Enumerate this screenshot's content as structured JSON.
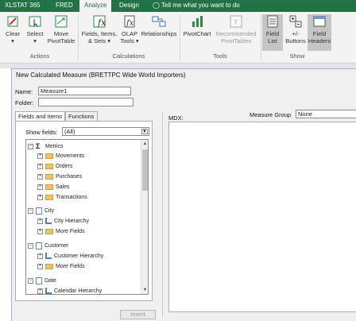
{
  "ribbon_tabs": [
    "XLSTAT 365",
    "FRED",
    "Analyze",
    "Design",
    "Tell me what you want to do"
  ],
  "ribbon": {
    "buttons": [
      {
        "label": "Clear",
        "sub": "▾"
      },
      {
        "label": "Select",
        "sub": "▾"
      },
      {
        "label": "Move",
        "sub": "PivotTable"
      },
      {
        "label": "Fields, Items,",
        "sub": "& Sets ▾"
      },
      {
        "label": "OLAP",
        "sub": "Tools ▾"
      },
      {
        "label": "Relationships",
        "sub": ""
      },
      {
        "label": "PivotChart",
        "sub": ""
      },
      {
        "label": "Recommended",
        "sub": "PivotTables"
      },
      {
        "label": "Field",
        "sub": "List"
      },
      {
        "label": "+/-",
        "sub": "Buttons"
      },
      {
        "label": "Field",
        "sub": "Headers"
      }
    ],
    "groups": [
      "Actions",
      "Calculations",
      "Tools",
      "Show"
    ]
  },
  "dialog": {
    "title": "New Calculated Measure (BRETTPC Wide World Importers)",
    "name_label": "Name:",
    "name_value": "Measure1",
    "folder_label": "Folder:",
    "folder_value": "",
    "tabs": [
      "Fields and Items",
      "Functions"
    ],
    "show_fields_label": "Show fields:",
    "show_fields_value": "(All)",
    "mdx_label": "MDX:",
    "measure_group_label": "Measure Group",
    "measure_group_value": "None",
    "insert_label": "Insert",
    "tree": [
      {
        "label": "Metrics",
        "icon": "sigma-icon",
        "exp": "−"
      },
      {
        "label": "Movements",
        "icon": "folder-icon",
        "exp": "+"
      },
      {
        "label": "Orders",
        "icon": "folder-icon",
        "exp": "+"
      },
      {
        "label": "Purchases",
        "icon": "folder-icon",
        "exp": "+"
      },
      {
        "label": "Sales",
        "icon": "folder-icon",
        "exp": "+"
      },
      {
        "label": "Transactions",
        "icon": "folder-icon",
        "exp": "+"
      },
      {
        "label": "City",
        "icon": "table-icon",
        "exp": "−"
      },
      {
        "label": "City Hierarchy",
        "icon": "hierarchy-icon",
        "exp": "+"
      },
      {
        "label": "More Fields",
        "icon": "folder-icon",
        "exp": "+"
      },
      {
        "label": "Customer",
        "icon": "table-icon",
        "exp": "−"
      },
      {
        "label": "Customer Hierarchy",
        "icon": "hierarchy-icon",
        "exp": "+"
      },
      {
        "label": "More Fields",
        "icon": "folder-icon",
        "exp": "+"
      },
      {
        "label": "Date",
        "icon": "table-icon",
        "exp": "−"
      },
      {
        "label": "Calendar Hierarchy",
        "icon": "hierarchy-icon",
        "exp": "+"
      }
    ]
  },
  "colors": {
    "excel_green": "#217346",
    "ribbon_bg": "#f3f3f3",
    "dialog_bg": "#f0f0f0"
  }
}
